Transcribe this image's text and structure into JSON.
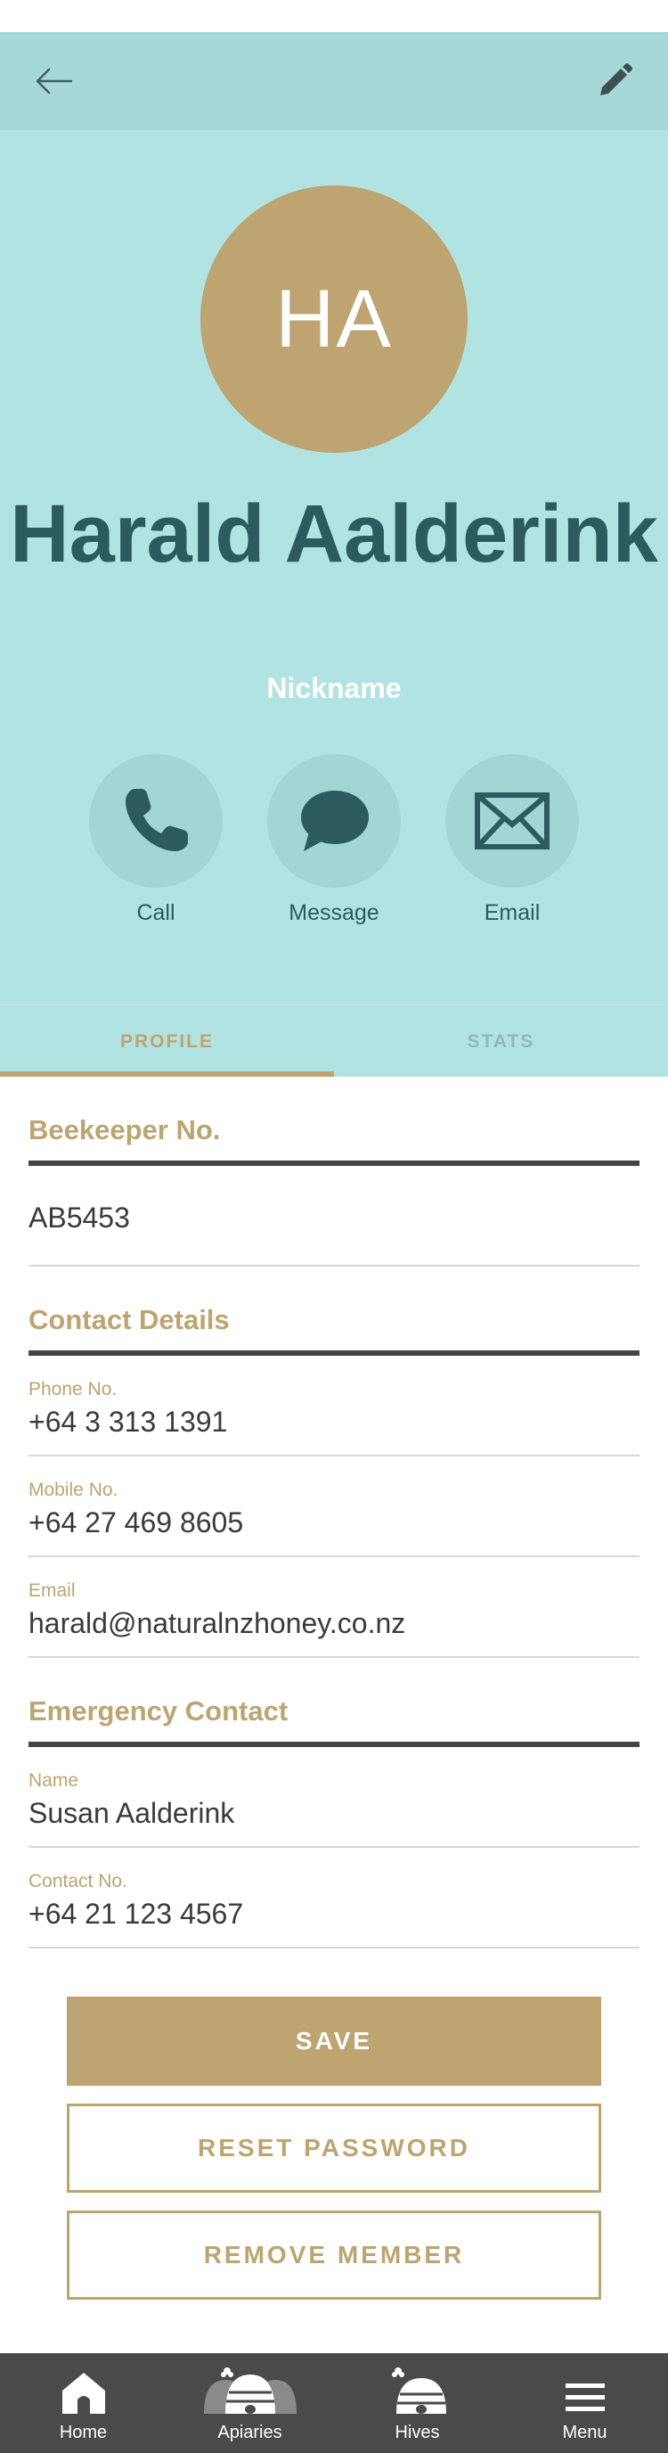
{
  "member": {
    "initials": "HA",
    "name": "Harald Aalderink",
    "nickname": "Nickname"
  },
  "actions": [
    {
      "label": "Call",
      "icon": "phone-icon"
    },
    {
      "label": "Message",
      "icon": "speech-bubble-icon"
    },
    {
      "label": "Email",
      "icon": "envelope-icon"
    }
  ],
  "tabs": [
    {
      "label": "PROFILE",
      "active": true
    },
    {
      "label": "STATS",
      "active": false
    }
  ],
  "beekeeper": {
    "title": "Beekeeper No.",
    "value": "AB5453"
  },
  "contact": {
    "title": "Contact Details",
    "phone_label": "Phone No.",
    "phone": "+64 3 313 1391",
    "mobile_label": "Mobile No.",
    "mobile": "+64 27 469 8605",
    "email_label": "Email",
    "email": "harald@naturalnzhoney.co.nz"
  },
  "emergency": {
    "title": "Emergency Contact",
    "name_label": "Name",
    "name": "Susan Aalderink",
    "number_label": "Contact No.",
    "number": "+64 21 123 4567"
  },
  "buttons": {
    "save": "SAVE",
    "reset": "RESET PASSWORD",
    "remove": "REMOVE MEMBER"
  },
  "nav": [
    {
      "label": "Home",
      "icon": "home-icon"
    },
    {
      "label": "Apiaries",
      "icon": "apiaries-icon"
    },
    {
      "label": "Hives",
      "icon": "hive-icon"
    },
    {
      "label": "Menu",
      "icon": "hamburger-menu-icon"
    }
  ],
  "colors": {
    "header": "#a7d8d8",
    "hero": "#b2e3e3",
    "accent": "#bda470",
    "name": "#2c5a5e",
    "nav": "#4a4a4a"
  }
}
